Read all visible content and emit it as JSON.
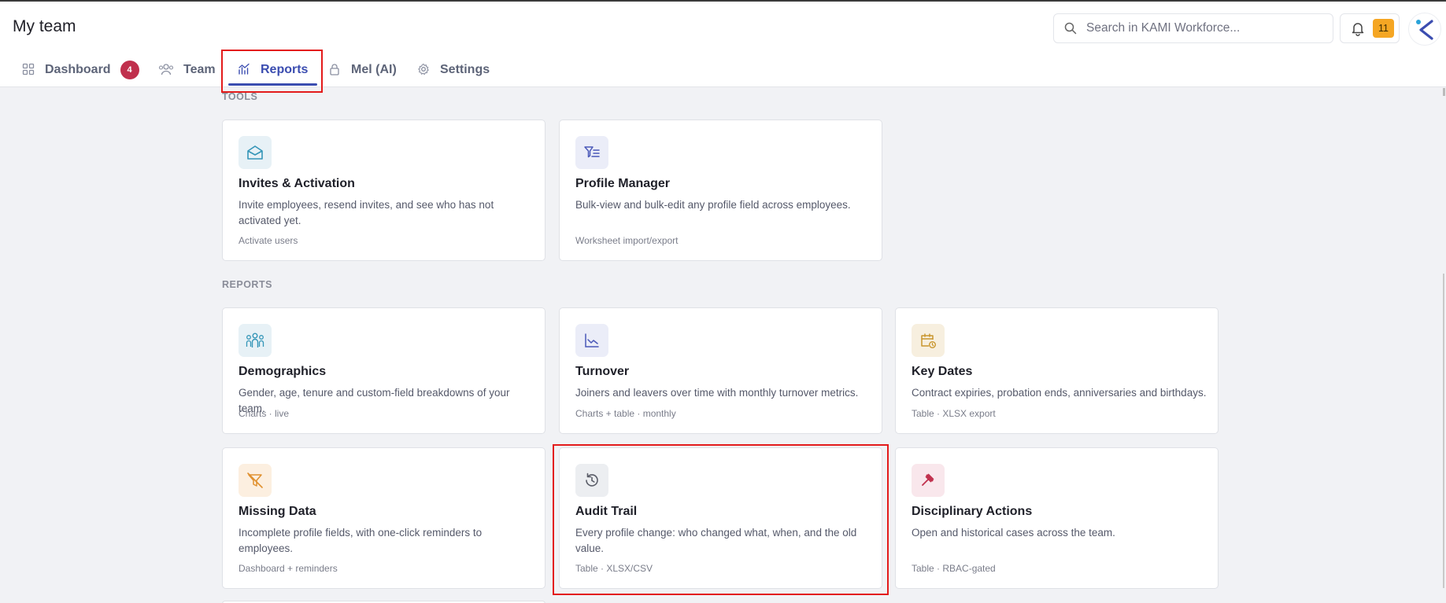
{
  "header": {
    "title": "My team",
    "search_placeholder": "Search in KAMI Workforce...",
    "notification_count": "11"
  },
  "tabs": [
    {
      "label": "Dashboard",
      "badge": "4",
      "icon": "grid-icon"
    },
    {
      "label": "Team",
      "icon": "people-icon"
    },
    {
      "label": "Reports",
      "icon": "chart-icon",
      "active": true
    },
    {
      "label": "Mel (AI)",
      "icon": "lock-icon"
    },
    {
      "label": "Settings",
      "icon": "gear-icon"
    }
  ],
  "sections": {
    "tools_label": "TOOLS",
    "reports_label": "REPORTS"
  },
  "tools": [
    {
      "title": "Invites & Activation",
      "description": "Invite employees, resend invites, and see who has not activated yet.",
      "meta": "Activate users",
      "icon": "envelope-open-icon"
    },
    {
      "title": "Profile Manager",
      "description": "Bulk-view and bulk-edit any profile field across employees.",
      "meta": "Worksheet import/export",
      "icon": "filter-list-icon"
    }
  ],
  "reports": [
    {
      "title": "Demographics",
      "description": "Gender, age, tenure and custom-field breakdowns of your team.",
      "meta": "Charts · live",
      "icon": "group-icon"
    },
    {
      "title": "Turnover",
      "description": "Joiners and leavers over time with monthly turnover metrics.",
      "meta": "Charts + table · monthly",
      "icon": "trend-chart-icon"
    },
    {
      "title": "Key Dates",
      "description": "Contract expiries, probation ends, anniversaries and birthdays.",
      "meta": "Table · XLSX export",
      "icon": "calendar-clock-icon"
    },
    {
      "title": "Missing Data",
      "description": "Incomplete profile fields, with one-click reminders to employees.",
      "meta": "Dashboard + reminders",
      "icon": "filter-off-icon"
    },
    {
      "title": "Audit Trail",
      "description": "Every profile change: who changed what, when, and the old value.",
      "meta": "Table · XLSX/CSV",
      "icon": "history-icon"
    },
    {
      "title": "Disciplinary Actions",
      "description": "Open and historical cases across the team.",
      "meta": "Table · RBAC-gated",
      "icon": "gavel-icon"
    }
  ],
  "colors": {
    "accent": "#3b4db0",
    "badge": "#c0304d",
    "notification": "#f5a623",
    "highlight": "#e31b1b"
  }
}
